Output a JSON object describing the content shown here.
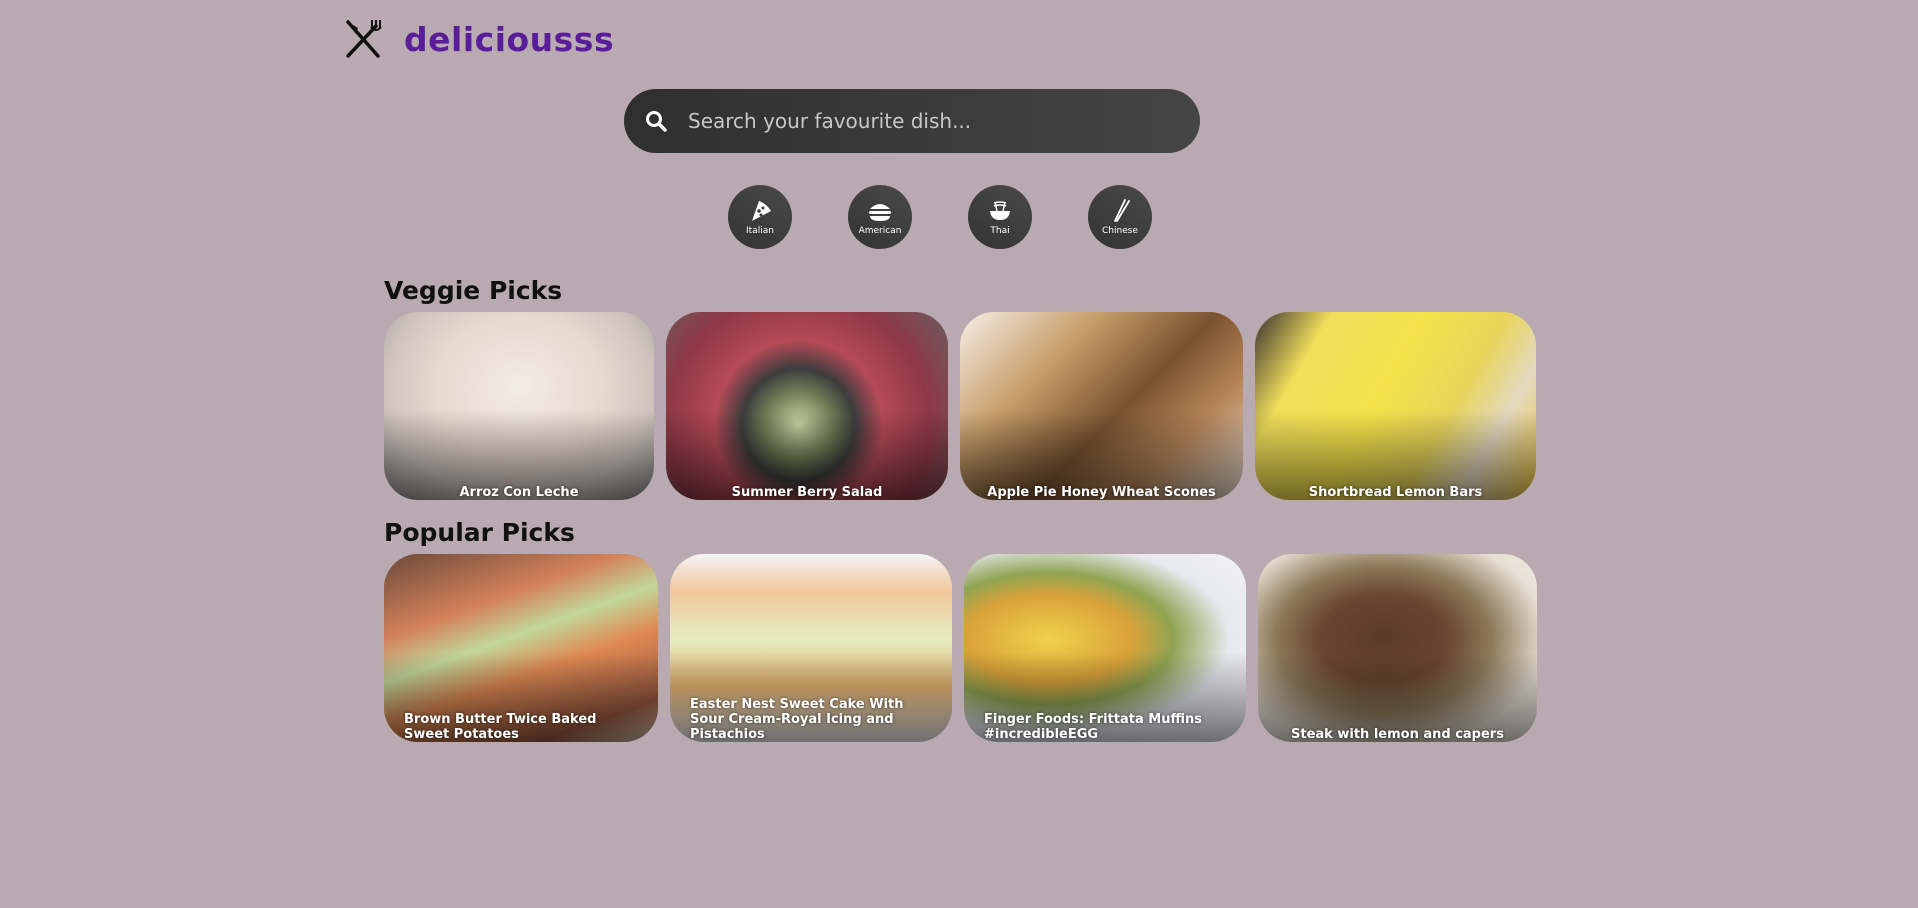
{
  "brand": {
    "name": "deliciousss"
  },
  "search": {
    "placeholder": "Search your favourite dish...",
    "value": ""
  },
  "cuisines": [
    {
      "label": "Italian",
      "icon": "pizza-icon"
    },
    {
      "label": "American",
      "icon": "burger-icon"
    },
    {
      "label": "Thai",
      "icon": "noodle-bowl-icon"
    },
    {
      "label": "Chinese",
      "icon": "chopsticks-icon"
    }
  ],
  "veggie": {
    "title": "Veggie Picks",
    "items": [
      {
        "title": "Arroz Con Leche"
      },
      {
        "title": "Summer Berry Salad"
      },
      {
        "title": "Apple Pie Honey Wheat Scones"
      },
      {
        "title": "Shortbread Lemon Bars"
      }
    ]
  },
  "popular": {
    "title": "Popular Picks",
    "items": [
      {
        "title": "Brown Butter Twice Baked Sweet Potatoes"
      },
      {
        "title": "Easter Nest Sweet Cake With Sour Cream-Royal Icing and Pistachios"
      },
      {
        "title": "Finger Foods: Frittata Muffins #incredibleEGG"
      },
      {
        "title": "Steak with lemon and capers"
      }
    ]
  },
  "colors": {
    "background": "#b8aab0",
    "brand": "#5a1d99",
    "search_bg": "#3a3a3a"
  }
}
